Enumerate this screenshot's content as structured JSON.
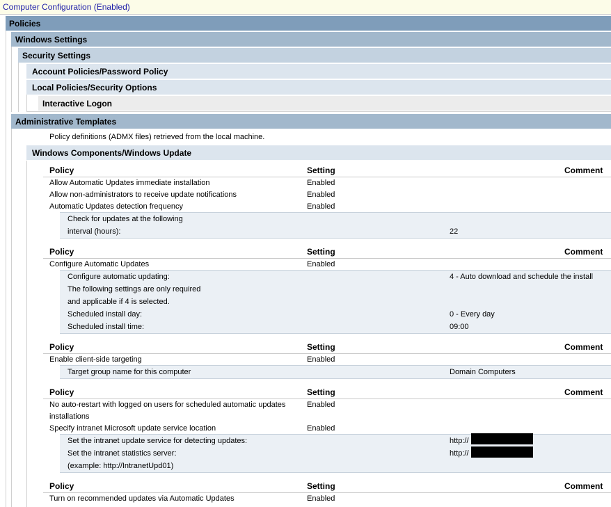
{
  "title": "Computer Configuration (Enabled)",
  "headers": {
    "policies": "Policies",
    "windows_settings": "Windows Settings",
    "security_settings": "Security Settings",
    "account_policies": "Account Policies/Password Policy",
    "local_policies": "Local Policies/Security Options",
    "interactive_logon": "Interactive Logon",
    "admin_templates": "Administrative Templates",
    "admx_note": "Policy definitions (ADMX files) retrieved from the local machine.",
    "windows_update": "Windows Components/Windows Update"
  },
  "columns": {
    "policy": "Policy",
    "setting": "Setting",
    "comment": "Comment"
  },
  "group1": {
    "rows": [
      {
        "policy": "Allow Automatic Updates immediate installation",
        "setting": "Enabled"
      },
      {
        "policy": "Allow non-administrators to receive update notifications",
        "setting": "Enabled"
      },
      {
        "policy": "Automatic Updates detection frequency",
        "setting": "Enabled"
      }
    ],
    "sub": {
      "line1": "Check for updates at the following",
      "line2": "interval (hours):",
      "value": "22"
    }
  },
  "group2": {
    "row": {
      "policy": "Configure Automatic Updates",
      "setting": "Enabled"
    },
    "sub": {
      "configure_label": "Configure automatic updating:",
      "configure_value": "4 - Auto download and schedule the install",
      "note1": "The following settings are only required",
      "note2": "and applicable if 4 is selected.",
      "day_label": "Scheduled install day:",
      "day_value": "0 - Every day",
      "time_label": "Scheduled install time:",
      "time_value": "09:00"
    }
  },
  "group3": {
    "row": {
      "policy": "Enable client-side targeting",
      "setting": "Enabled"
    },
    "sub": {
      "label": "Target group name for this computer",
      "value": "Domain Computers"
    }
  },
  "group4": {
    "row1": {
      "policy_line1": "No auto-restart with logged on users for scheduled automatic updates",
      "policy_line2": "installations",
      "setting": "Enabled"
    },
    "row2": {
      "policy": "Specify intranet Microsoft update service location",
      "setting": "Enabled"
    },
    "sub": {
      "detect_label": "Set the intranet update service for detecting updates:",
      "detect_value": "http://",
      "stats_label": "Set the intranet statistics server:",
      "stats_value": "http://",
      "example": "(example: http://IntranetUpd01)"
    }
  },
  "group5": {
    "row": {
      "policy": "Turn on recommended updates via Automatic Updates",
      "setting": "Enabled"
    }
  }
}
